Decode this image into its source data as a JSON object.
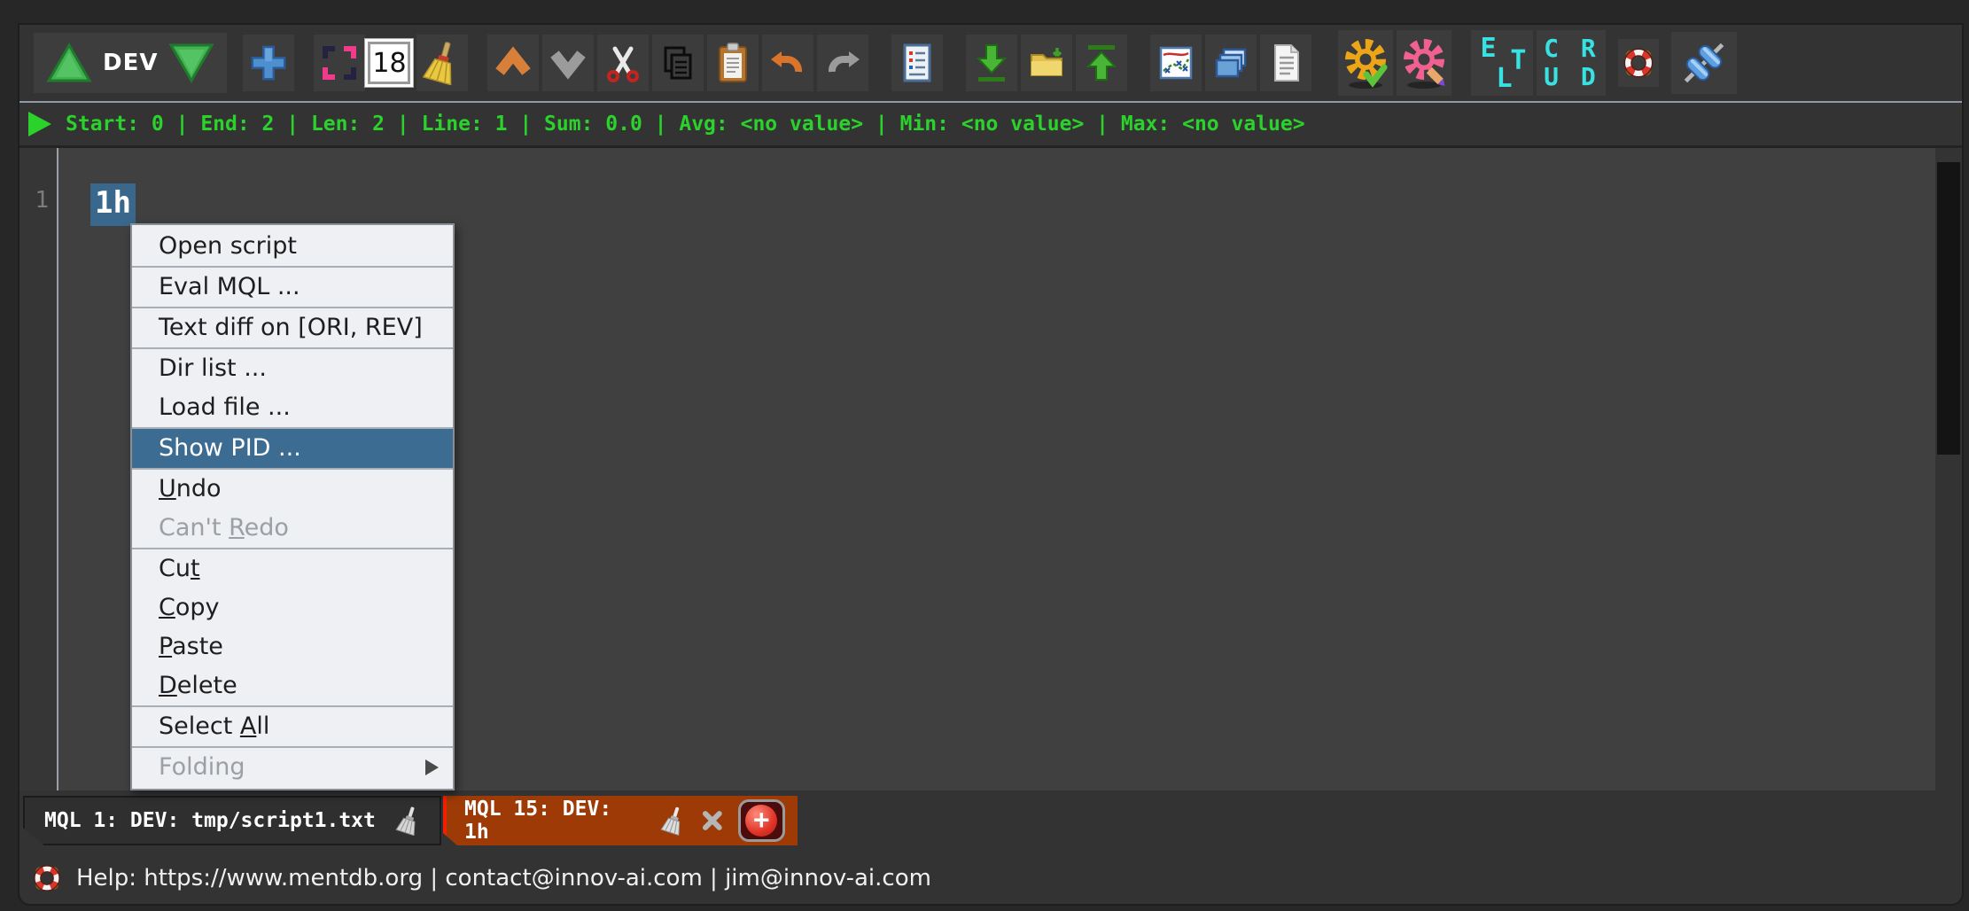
{
  "toolbar": {
    "env_label": "DEV",
    "font_size_value": "18",
    "elt": {
      "e": "E",
      "l": "L",
      "t": "T"
    },
    "crud": {
      "row1": "C R",
      "row2": "U D"
    },
    "icon_names": [
      "deploy-up-triangle",
      "deploy-down-triangle",
      "add-plus",
      "select-region-brackets",
      "font-size-field",
      "clean-broom",
      "scroll-up-chevron",
      "scroll-down-chevron",
      "cut-scissors",
      "copy-pages",
      "paste-clipboard",
      "undo-arrow",
      "redo-arrow",
      "script-log-document",
      "download-arrow",
      "folder",
      "upload-arrow",
      "chart",
      "windows-stack",
      "document",
      "settings-gear-check",
      "settings-gear-edit",
      "elt-letters",
      "crud-letters",
      "lifebuoy",
      "connector-plug"
    ]
  },
  "statusbar": {
    "stats": "Start: 0 | End: 2 | Len: 2 | Line: 1 | Sum: 0.0 | Avg: <no value> | Min: <no value> | Max: <no value>"
  },
  "editor": {
    "line_number": "1",
    "selected_text": "1h"
  },
  "context_menu": {
    "items": [
      {
        "id": "open-script",
        "pre": "Open script"
      },
      {
        "id": "eval-mql",
        "pre": "Eval MQL ..."
      },
      {
        "id": "text-diff",
        "pre": "Text diff on [ORI, REV]"
      },
      {
        "id": "dir-list",
        "pre": "Dir list ..."
      },
      {
        "id": "load-file",
        "pre": "Load file ..."
      },
      {
        "id": "show-pid",
        "pre": "Show PID ...",
        "state": "highlighted"
      },
      {
        "id": "undo",
        "mn": "U",
        "post": "ndo"
      },
      {
        "id": "cant-redo",
        "pre": "Can't ",
        "mn": "R",
        "post": "edo",
        "state": "disabled"
      },
      {
        "id": "cut",
        "pre": "Cu",
        "mn": "t"
      },
      {
        "id": "copy",
        "mn": "C",
        "post": "opy"
      },
      {
        "id": "paste",
        "mn": "P",
        "post": "aste"
      },
      {
        "id": "delete",
        "mn": "D",
        "post": "elete"
      },
      {
        "id": "select-all",
        "pre": "Select ",
        "mn": "A",
        "post": "ll"
      },
      {
        "id": "folding",
        "pre": "Folding",
        "state": "disabled",
        "has_submenu": true
      }
    ]
  },
  "tabs": {
    "items": [
      {
        "title": "MQL 1: DEV: tmp/script1.txt",
        "active": false
      },
      {
        "title": "MQL 15: DEV: 1h",
        "active": true
      }
    ],
    "plus_glyph": "+"
  },
  "help": {
    "text": "Help: https://www.mentdb.org | contact@innov-ai.com | jim@innov-ai.com"
  },
  "colors": {
    "accent_green": "#2bd22b",
    "selection_blue": "#3a678c",
    "menu_highlight": "#3d6c93",
    "active_tab": "#9e3a06",
    "active_tab_border": "#f32000",
    "cyan_letters": "#38e2e2"
  }
}
